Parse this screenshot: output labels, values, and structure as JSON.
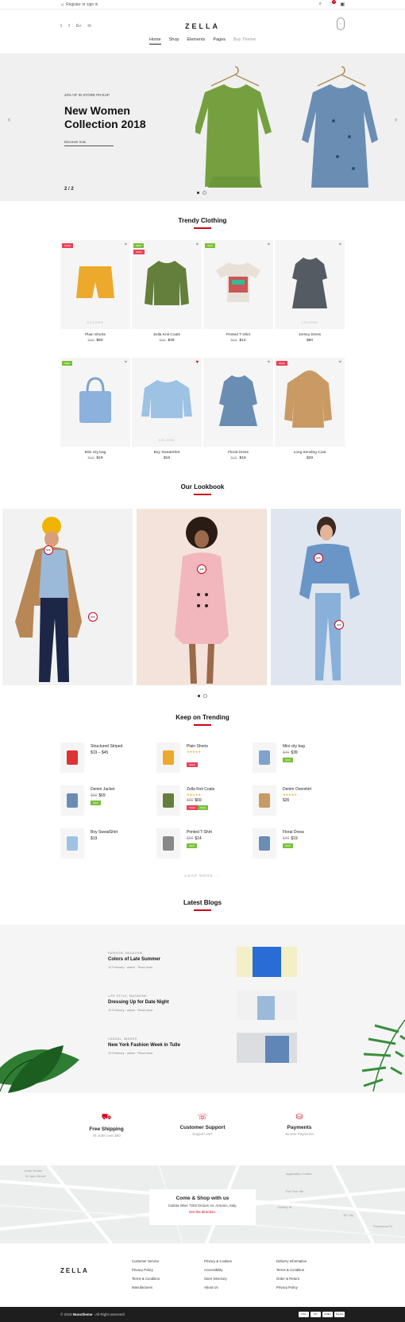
{
  "topbar": {
    "register": "Register or sign in",
    "cart_count": "0"
  },
  "logo": "ZELLA",
  "nav": [
    "Home",
    "Shop",
    "Elements",
    "Pages",
    "Buy Theme"
  ],
  "hero": {
    "eyebrow": "20% OF IN STORE PICKUP",
    "title_line1": "New Women",
    "title_line2": "Collection 2018",
    "cta": "Discover now",
    "page": "2 / 2"
  },
  "trendy": {
    "title": "Trendy Clothing",
    "colors_label": "COLORS",
    "products": [
      {
        "name": "Plain Shorts",
        "old": "$98",
        "price": "$60",
        "tag": "SALE"
      },
      {
        "name": "Zella Knit Coats",
        "old": "$98",
        "price": "$39",
        "tag": "NEW",
        "tag2": "SALE"
      },
      {
        "name": "Printed T-Shirt",
        "old": "$98",
        "price": "$14",
        "tag": "NEW"
      },
      {
        "name": "Jersey Dress",
        "old": "",
        "price": "$90",
        "tag": ""
      },
      {
        "name": "Mini city bag",
        "old": "$46",
        "price": "$19",
        "tag": "NEW"
      },
      {
        "name": "Boy SweatShirt",
        "old": "",
        "price": "$19",
        "tag": ""
      },
      {
        "name": "Floral Dress",
        "old": "$46",
        "price": "$19",
        "tag": ""
      },
      {
        "name": "Long trending Coat",
        "old": "",
        "price": "$29",
        "tag": "SALE"
      }
    ]
  },
  "lookbook": {
    "title": "Our Lookbook",
    "pins": [
      "$35",
      "$29",
      "$48",
      "$35",
      "$29"
    ]
  },
  "keep": {
    "title": "Keep on Trending",
    "load_more": "LOAD MORE ...",
    "items": [
      {
        "name": "Structured Striped",
        "price": "$19 – $45"
      },
      {
        "name": "Plain Shorts",
        "price": "",
        "pill": "SALE"
      },
      {
        "name": "Mini city bag",
        "old": "$46",
        "price": "$39",
        "pill": "NEW"
      },
      {
        "name": "Denim Jacket",
        "old": "$90",
        "price": "$69",
        "pill": "NEW"
      },
      {
        "name": "Zella Knit Coats",
        "old": "$90",
        "price": "$69",
        "pill": "SALE",
        "pill2": "NEW"
      },
      {
        "name": "Denim Overshirt",
        "price": "$35"
      },
      {
        "name": "Boy SweatShirt",
        "price": "$19"
      },
      {
        "name": "Printed T-Shirt",
        "old": "$98",
        "price": "$14",
        "pill": "NEW"
      },
      {
        "name": "Floral Dress",
        "old": "$46",
        "price": "$19",
        "pill": "NEW"
      }
    ]
  },
  "blogs": {
    "title": "Latest Blogs",
    "posts": [
      {
        "cat": "FASHION, MAGAZINE",
        "title": "Colors of Late Summer",
        "meta": "12 February · admin · Read more"
      },
      {
        "cat": "LIFE STYLE, MAGAZINE",
        "title": "Dressing Up for Date Night",
        "meta": "12 February · admin · Read more"
      },
      {
        "cat": "CASUAL, IMAGES",
        "title": "New York Fashion Week in Tulle",
        "meta": "12 February · admin · Read more"
      }
    ]
  },
  "features": [
    {
      "title": "Free Shipping",
      "sub": "All order over $50"
    },
    {
      "title": "Customer Support",
      "sub": "Support 24/7"
    },
    {
      "title": "Payments",
      "sub": "Secure Payments"
    }
  ],
  "map": {
    "title": "Come & Shop with us",
    "address": "Calista Wise 7292 Dictum Av. Antonio, Italy.",
    "link": "Get the direction.",
    "labels": [
      "Lewis House",
      "St John Street",
      "Application Centre",
      "Fex Tour Hill",
      "Dudley St",
      "JD City",
      "Rosewood St"
    ]
  },
  "footer": {
    "logo": "ZELLA",
    "cols": [
      [
        "Customer Service",
        "Privacy Policy",
        "Terms & Condition",
        "Manufactures"
      ],
      [
        "Privacy & Cookies",
        "Accessibility",
        "Store Directory",
        "About Us"
      ],
      [
        "Delivery Information",
        "Terms & Condition",
        "Order & Return",
        "Privacy Policy"
      ]
    ]
  },
  "copyright": {
    "year": "© 2018",
    "brand": "Nooctheme",
    "rest": " - All Right reserved!"
  },
  "cards": [
    "VISA",
    "MC",
    "AMEX",
    "PayPal"
  ],
  "colors": {
    "accent": "#d0021b",
    "new": "#7bbf3a",
    "sale": "#e8435a"
  }
}
